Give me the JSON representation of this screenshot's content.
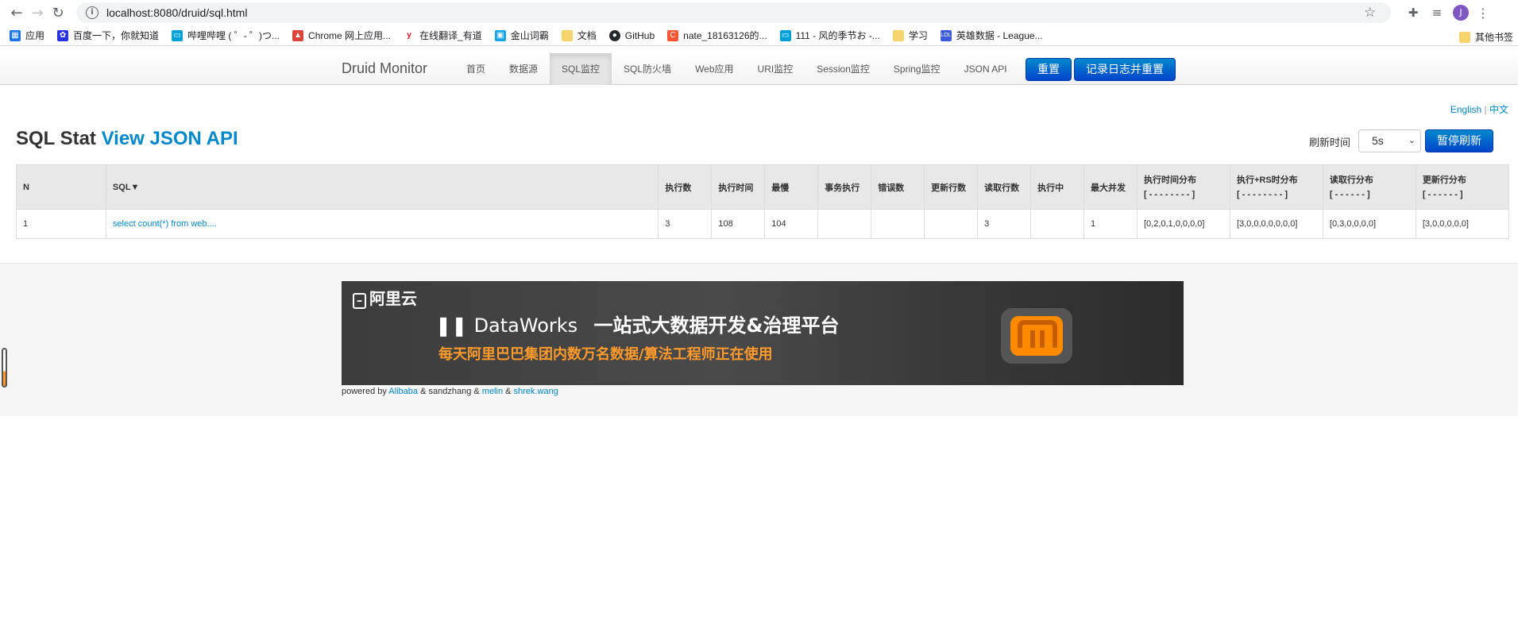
{
  "browser": {
    "url": "localhost:8080/druid/sql.html",
    "profile_initial": "J",
    "bookmarks": [
      {
        "label": "应用",
        "color": "#1a73e8"
      },
      {
        "label": "百度一下，你就知道",
        "color": "#2932e1"
      },
      {
        "label": "哔哩哔哩 ( ゜- ゜)つ...",
        "color": "#00a1d6"
      },
      {
        "label": "Chrome 网上应用...",
        "color": "#db4437"
      },
      {
        "label": "在线翻译_有道",
        "color": "#e60012"
      },
      {
        "label": "金山词霸",
        "color": "#12a3e8"
      },
      {
        "label": "文档",
        "color": "#f6d36b"
      },
      {
        "label": "GitHub",
        "color": "#24292e"
      },
      {
        "label": "nate_18163126的...",
        "color": "#fc5531"
      },
      {
        "label": "111 - 风的季节お -...",
        "color": "#00a1d6"
      },
      {
        "label": "学习",
        "color": "#f6d36b"
      },
      {
        "label": "英雄数据 - League...",
        "color": "#3b5bdb"
      }
    ],
    "other_bookmarks": "其他书签"
  },
  "navbar": {
    "brand": "Druid Monitor",
    "items": [
      "首页",
      "数据源",
      "SQL监控",
      "SQL防火墙",
      "Web应用",
      "URI监控",
      "Session监控",
      "Spring监控",
      "JSON API"
    ],
    "active_index": 2,
    "reset_label": "重置",
    "log_reset_label": "记录日志并重置"
  },
  "lang": {
    "english": "English",
    "sep": "|",
    "chinese": "中文"
  },
  "title": {
    "main": "SQL Stat",
    "link": "View JSON API"
  },
  "refresh": {
    "label": "刷新时间",
    "value": "5s",
    "pause_label": "暂停刷新"
  },
  "table": {
    "headers": [
      "N",
      "SQL▼",
      "执行数",
      "执行时间",
      "最慢",
      "事务执行",
      "错误数",
      "更新行数",
      "读取行数",
      "执行中",
      "最大并发"
    ],
    "dist_headers": [
      {
        "title": "执行时间分布",
        "sub": "[ - - - - - - - - ]"
      },
      {
        "title": "执行+RS时分布",
        "sub": "[ - - - - - - - - ]"
      },
      {
        "title": "读取行分布",
        "sub": "[ - - - - - - ]"
      },
      {
        "title": "更新行分布",
        "sub": "[ - - - - - - ]"
      }
    ],
    "rows": [
      {
        "n": "1",
        "sql": "select count(*) from web....",
        "exec_count": "3",
        "exec_time": "108",
        "slowest": "104",
        "tx_exec": "",
        "errors": "",
        "update_rows": "",
        "read_rows": "3",
        "running": "",
        "max_concurrent": "1",
        "exec_dist": "[0,2,0,1,0,0,0,0]",
        "exec_rs_dist": "[3,0,0,0,0,0,0,0]",
        "read_dist": "[0,3,0,0,0,0]",
        "update_dist": "[3,0,0,0,0,0]"
      }
    ]
  },
  "banner": {
    "brand": "阿里云",
    "product": "DataWorks",
    "tagline": "一站式大数据开发&治理平台",
    "subtitle": "每天阿里巴巴集团内数万名数据/算法工程师正在使用"
  },
  "footer": {
    "powered_by": "powered by",
    "alibaba": "Alibaba",
    "amp1": "& sandzhang &",
    "melin": "melin",
    "amp2": "&",
    "shrek": "shrek.wang"
  }
}
